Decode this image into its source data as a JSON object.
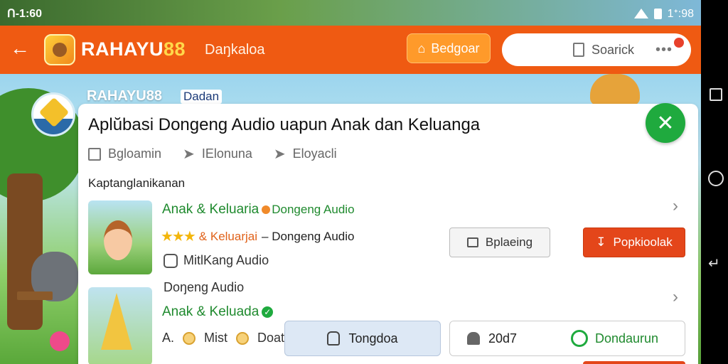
{
  "status_bar": {
    "time": "ᑎ-1:60",
    "clock_right": "1ᐩ:98"
  },
  "header": {
    "brand_prefix": "RAHAYU",
    "brand_suffix": "88",
    "subtitle": "Daŋkaloa",
    "action_button_label": "Bedgoar",
    "search_label": "Soarick",
    "colors": {
      "bar": "#ef5a12",
      "brand_accent": "#ffd84a"
    }
  },
  "background": {
    "brand_text": "RAHAYU88",
    "badge_text": "Dadan"
  },
  "panel": {
    "title": "Aplŭbasi Dongeng Audio uapun Anak dan Keluanga",
    "meta": [
      {
        "label": "Bgloamin",
        "icon": "square-icon"
      },
      {
        "label": "IElonuna",
        "icon": "arrow-icon"
      },
      {
        "label": "Eloyacli",
        "icon": "arrow-icon"
      }
    ],
    "section_label": "Kaptanglanikanan",
    "items": [
      {
        "title": "Anak & Keluaria",
        "tag": "Dongeng Audio",
        "rating_label": "& Keluarjai",
        "rating_suffix": "– Dongeng Audio",
        "sub_line": "MitlKang Audio",
        "secondary_button": "Bplaeing",
        "primary_button": "Popkioolak"
      },
      {
        "kicker": "Doŋeng Audio",
        "title": "Anak & Keluada",
        "meta_a": "A.",
        "meta_b": "Mist",
        "meta_c": "Doatn",
        "blue_button": "Tongdoa",
        "split_left": "20d7",
        "split_right": "Dondaurun"
      }
    ]
  }
}
